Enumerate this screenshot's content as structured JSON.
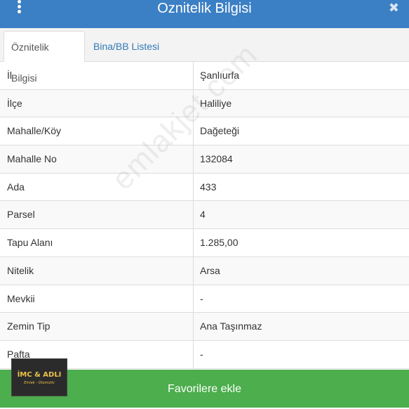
{
  "header": {
    "title": "Oznitelik Bilgisi",
    "menu_icon": "kebab-icon",
    "close_icon": "close-icon"
  },
  "tabs": [
    {
      "label": "Öznitelik Bilgisi",
      "active": true
    },
    {
      "label": "Bina/BB Listesi",
      "active": false
    }
  ],
  "attributes": [
    {
      "key": "İl",
      "value": "Şanlıurfa"
    },
    {
      "key": "İlçe",
      "value": "Haliliye"
    },
    {
      "key": "Mahalle/Köy",
      "value": "Dağeteği"
    },
    {
      "key": "Mahalle No",
      "value": "132084"
    },
    {
      "key": "Ada",
      "value": "433"
    },
    {
      "key": "Parsel",
      "value": "4"
    },
    {
      "key": "Tapu Alanı",
      "value": "1.285,00"
    },
    {
      "key": "Nitelik",
      "value": "Arsa"
    },
    {
      "key": "Mevkii",
      "value": "-"
    },
    {
      "key": "Zemin Tip",
      "value": "Ana Taşınmaz"
    },
    {
      "key": "Pafta",
      "value": "-"
    }
  ],
  "watermark": "emlakjet.com",
  "logo": {
    "line1": "İMC & ADLI",
    "line2": "Emlak - Otomotiv"
  },
  "footer": {
    "button_label": "Favorilere ekle"
  },
  "colors": {
    "header": "#3b7fc4",
    "footer": "#4cae4c",
    "link": "#337ab7"
  }
}
